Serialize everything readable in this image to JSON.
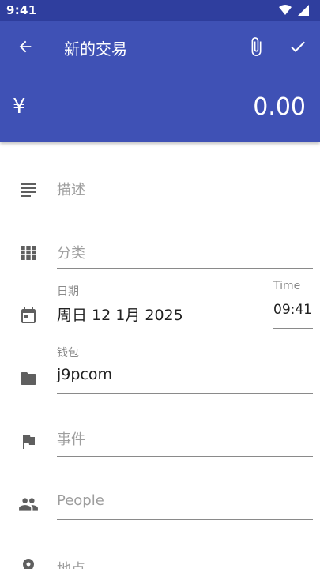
{
  "status_bar": {
    "time": "9:41"
  },
  "toolbar": {
    "title": "新的交易",
    "back_icon": "arrow-back-icon",
    "attach_icon": "paperclip-icon",
    "save_icon": "check-icon"
  },
  "amount": {
    "currency_symbol": "¥",
    "value": "0.00"
  },
  "form": {
    "description": {
      "placeholder": "描述",
      "icon": "notes-icon"
    },
    "category": {
      "placeholder": "分类",
      "icon": "grid-icon"
    },
    "date": {
      "label": "日期",
      "value": "周日 12 1月 2025",
      "icon": "calendar-icon"
    },
    "time": {
      "label": "Time",
      "value": "09:41"
    },
    "wallet": {
      "label": "钱包",
      "value": "j9pcom",
      "icon": "folder-icon"
    },
    "event": {
      "placeholder": "事件",
      "icon": "flag-icon"
    },
    "people": {
      "placeholder": "People",
      "icon": "people-icon"
    },
    "location": {
      "placeholder": "地点",
      "icon": "location-pin-icon"
    }
  },
  "colors": {
    "primary": "#3f51b5",
    "primary_dark": "#2f3e9e",
    "icon_gray": "#5f5f5f",
    "hint_gray": "#9e9e9e"
  }
}
